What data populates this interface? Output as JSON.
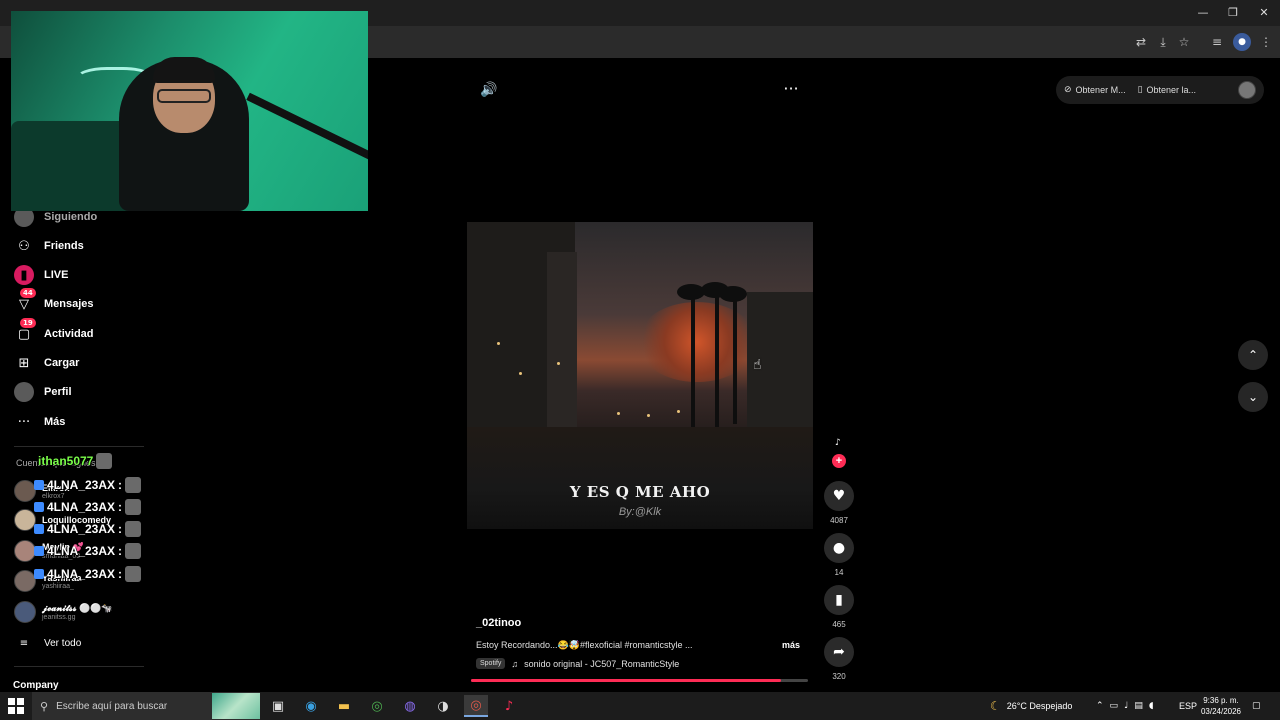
{
  "window": {
    "minimize": "—",
    "restore": "❐",
    "close": "✕"
  },
  "browser_toolbar": {
    "icons": [
      "translate-icon",
      "install-icon",
      "star-icon",
      "media-icon",
      "profile-icon",
      "menu-icon"
    ]
  },
  "top_bar": {
    "volume_icon": "🔊",
    "more_icon": "···",
    "get_coins_label": "Obtener M...",
    "get_app_label": "Obtener la..."
  },
  "sidebar": {
    "items": [
      {
        "label": "Siguiendo",
        "icon": "avatar-icon"
      },
      {
        "label": "Friends",
        "icon": "friends-icon"
      },
      {
        "label": "LIVE",
        "icon": "live-icon"
      },
      {
        "label": "Mensajes",
        "icon": "messages-icon",
        "badge": "44"
      },
      {
        "label": "Actividad",
        "icon": "activity-icon",
        "badge": "19"
      },
      {
        "label": "Cargar",
        "icon": "upload-icon"
      },
      {
        "label": "Perfil",
        "icon": "profile-icon"
      },
      {
        "label": "Más",
        "icon": "more-icon"
      }
    ],
    "following_title": "Cuentas que sigues",
    "accounts": [
      {
        "name": "Elkrox",
        "handle": "elkrox7"
      },
      {
        "name": "Loquillocomedy",
        "handle": ""
      },
      {
        "name": "Maylin 💕",
        "handle": "smarllaa_03"
      },
      {
        "name": "Yashiiraa",
        "handle": "yashiiraa_"
      },
      {
        "name": "𝓳𝓮𝓪𝓷𝓲𝓽𝓼𝓼 ⚪⚪🐄",
        "handle": "jeanitss.gg"
      }
    ],
    "see_all": "Ver todo",
    "company": "Company"
  },
  "chat_overlay": [
    {
      "user": "ithan5077",
      "text": ""
    },
    {
      "user": "4LNA_23AX",
      "text": ":"
    },
    {
      "user": "4LNA_23AX",
      "text": ":"
    },
    {
      "user": "4LNA_23AX",
      "text": ":"
    },
    {
      "user": "4LNA_23AX",
      "text": ":"
    },
    {
      "user": "4LNA_23AX",
      "text": ":"
    }
  ],
  "video": {
    "caption": "Y ES Q ME AHO",
    "credit": "By:@Klk",
    "username": "_02tinoo",
    "description": "Estoy Recordando...😂🤯#flexoficial #romanticstyle ...",
    "more": "más",
    "spotify_tag": "Spotify",
    "music_icon": "♫",
    "sound": "sonido original - JC507_RomanticStyle",
    "progress": 0.92
  },
  "actions": {
    "music_note": "♪",
    "follow": "+",
    "likes": "4087",
    "comments": "14",
    "saves": "465",
    "shares": "320"
  },
  "navigation": {
    "up": "⌃",
    "down": "⌄"
  },
  "taskbar": {
    "search_placeholder": "Escribe aquí para buscar",
    "weather": "26°C  Despejado",
    "language": "ESP",
    "time": "9:36 p. m.",
    "date": "03/24/2026"
  },
  "colors": {
    "accent": "#fe2c55",
    "background": "#000000",
    "chat_green": "#7bff4a"
  }
}
